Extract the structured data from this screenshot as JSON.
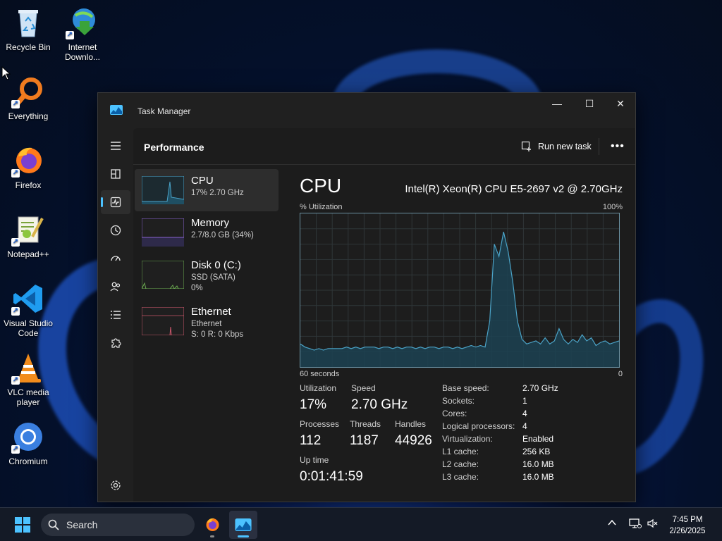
{
  "desktop": {
    "icons": [
      {
        "label": "Recycle Bin",
        "icon": "recycle-bin-icon"
      },
      {
        "label": "Internet Downlo...",
        "icon": "internet-download-manager-icon"
      },
      {
        "label": "Everything",
        "icon": "everything-search-icon"
      },
      {
        "label": "Firefox",
        "icon": "firefox-icon"
      },
      {
        "label": "Notepad++",
        "icon": "notepadpp-icon"
      },
      {
        "label": "Visual Studio Code",
        "icon": "vscode-icon"
      },
      {
        "label": "VLC media player",
        "icon": "vlc-icon"
      },
      {
        "label": "Chromium",
        "icon": "chromium-icon"
      }
    ]
  },
  "window": {
    "title": "Task Manager",
    "controls": {
      "minimize": "—",
      "maximize": "☐",
      "close": "✕"
    }
  },
  "header": {
    "page_title": "Performance",
    "run_task": "Run new task",
    "more": "•••"
  },
  "resources": [
    {
      "name": "CPU",
      "line1": "17% 2.70 GHz",
      "line2": "",
      "line3": ""
    },
    {
      "name": "Memory",
      "line1": "2.7/8.0 GB (34%)",
      "line2": "",
      "line3": ""
    },
    {
      "name": "Disk 0 (C:)",
      "line1": "SSD (SATA)",
      "line2": "0%",
      "line3": ""
    },
    {
      "name": "Ethernet",
      "line1": "Ethernet",
      "line2": "S: 0 R: 0 Kbps",
      "line3": ""
    }
  ],
  "cpu": {
    "title": "CPU",
    "model": "Intel(R) Xeon(R) CPU E5-2697 v2 @ 2.70GHz",
    "util_label": "% Utilization",
    "max_label": "100%",
    "time_label": "60 seconds",
    "zero_label": "0",
    "history": [
      15,
      13,
      12,
      11,
      12,
      11,
      12,
      12,
      12,
      12,
      13,
      12,
      13,
      12,
      13,
      13,
      13,
      12,
      13,
      13,
      12,
      13,
      12,
      13,
      13,
      12,
      13,
      12,
      13,
      13,
      12,
      13,
      13,
      12,
      13,
      12,
      13,
      14,
      13,
      14,
      13,
      30,
      80,
      72,
      88,
      75,
      55,
      30,
      18,
      15,
      16,
      17,
      15,
      19,
      15,
      17,
      25,
      18,
      15,
      18,
      16,
      21,
      17,
      19,
      14,
      16,
      17,
      15,
      16,
      17
    ],
    "stats": {
      "utilization_label": "Utilization",
      "utilization": "17%",
      "speed_label": "Speed",
      "speed": "2.70 GHz",
      "processes_label": "Processes",
      "processes": "112",
      "threads_label": "Threads",
      "threads": "1187",
      "handles_label": "Handles",
      "handles": "44926",
      "uptime_label": "Up time",
      "uptime": "0:01:41:59"
    },
    "specs": [
      {
        "k": "Base speed:",
        "v": "2.70 GHz"
      },
      {
        "k": "Sockets:",
        "v": "1"
      },
      {
        "k": "Cores:",
        "v": "4"
      },
      {
        "k": "Logical processors:",
        "v": "4"
      },
      {
        "k": "Virtualization:",
        "v": "Enabled"
      },
      {
        "k": "L1 cache:",
        "v": "256 KB"
      },
      {
        "k": "L2 cache:",
        "v": "16.0 MB"
      },
      {
        "k": "L3 cache:",
        "v": "16.0 MB"
      }
    ]
  },
  "taskbar": {
    "search_placeholder": "Search",
    "time": "7:45 PM",
    "date": "2/26/2025"
  },
  "colors": {
    "accent": "#4cc2ff",
    "cpu_line": "#4ba3c7",
    "memory_line": "#8a63d2",
    "disk_line": "#6aa84f",
    "ethernet_line": "#c7566a"
  }
}
